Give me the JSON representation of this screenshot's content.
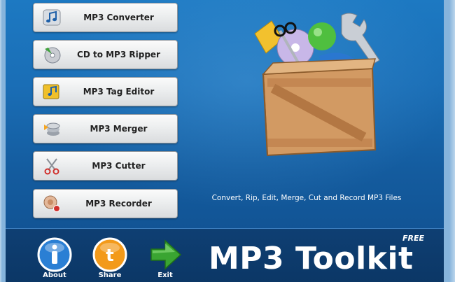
{
  "menu": {
    "items": [
      {
        "label": "MP3 Converter",
        "icon": "music-note-icon"
      },
      {
        "label": "CD to MP3 Ripper",
        "icon": "cd-icon"
      },
      {
        "label": "MP3 Tag Editor",
        "icon": "tag-note-icon"
      },
      {
        "label": "MP3 Merger",
        "icon": "merge-icon"
      },
      {
        "label": "MP3 Cutter",
        "icon": "scissors-icon"
      },
      {
        "label": "MP3 Recorder",
        "icon": "record-icon"
      }
    ]
  },
  "tagline": "Convert, Rip, Edit, Merge, Cut and Record MP3 Files",
  "bottom": {
    "about_label": "About",
    "share_label": "Share",
    "exit_label": "Exit"
  },
  "logo": {
    "title": "MP3 Toolkit",
    "badge": "FREE"
  },
  "colors": {
    "background_blue": "#1a6eb6",
    "bottom_bar": "#0e3f73",
    "button_face": "#eceeef",
    "about_icon": "#2a7fd4",
    "share_icon": "#f39a1a",
    "exit_icon": "#3aa532"
  }
}
